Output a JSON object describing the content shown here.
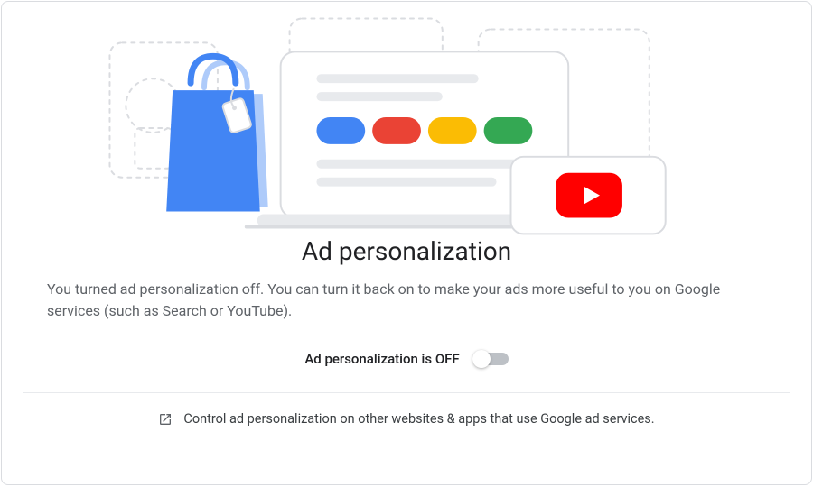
{
  "card": {
    "title": "Ad personalization",
    "description": "You turned ad personalization off. You can turn it back on to make your ads more useful to you on Google services (such as Search or YouTube).",
    "toggle": {
      "label": "Ad personalization is OFF",
      "state": "off"
    },
    "footerLink": "Control ad personalization on other websites & apps that use Google ad services."
  },
  "colors": {
    "blue": "#4285f4",
    "red": "#ea4335",
    "yellow": "#fbbc04",
    "green": "#34a853",
    "youtube_red": "#ff0000"
  }
}
